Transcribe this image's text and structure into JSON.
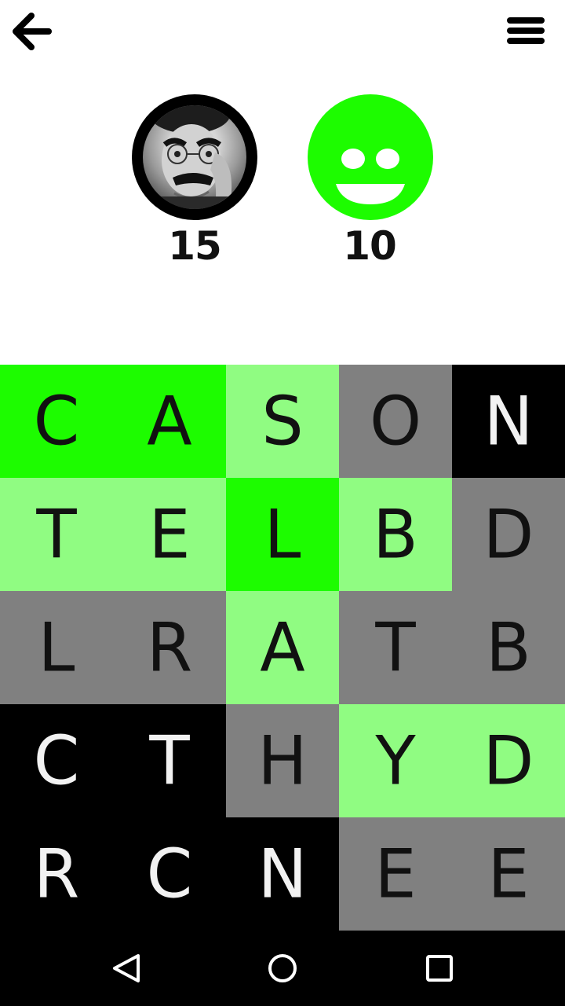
{
  "toolbar": {
    "back_icon": "arrow-left-icon",
    "menu_icon": "hamburger-menu-icon"
  },
  "players": [
    {
      "avatar": "player-photo",
      "score": "15"
    },
    {
      "avatar": "green-smiley",
      "score": "10"
    }
  ],
  "colors": {
    "bright_green": "#1dfc00",
    "light_green": "#90fc82",
    "gray": "#808080",
    "black": "#000000",
    "dark_letter": "#111111",
    "light_letter": "#f2f2f2"
  },
  "board": {
    "rows": [
      [
        {
          "letter": "C",
          "state": "bright_green"
        },
        {
          "letter": "A",
          "state": "bright_green"
        },
        {
          "letter": "S",
          "state": "light_green"
        },
        {
          "letter": "O",
          "state": "gray"
        },
        {
          "letter": "N",
          "state": "black"
        }
      ],
      [
        {
          "letter": "T",
          "state": "light_green"
        },
        {
          "letter": "E",
          "state": "light_green"
        },
        {
          "letter": "L",
          "state": "bright_green"
        },
        {
          "letter": "B",
          "state": "light_green"
        },
        {
          "letter": "D",
          "state": "gray"
        }
      ],
      [
        {
          "letter": "L",
          "state": "gray"
        },
        {
          "letter": "R",
          "state": "gray"
        },
        {
          "letter": "A",
          "state": "light_green"
        },
        {
          "letter": "T",
          "state": "gray"
        },
        {
          "letter": "B",
          "state": "gray"
        }
      ],
      [
        {
          "letter": "C",
          "state": "black"
        },
        {
          "letter": "T",
          "state": "black"
        },
        {
          "letter": "H",
          "state": "gray"
        },
        {
          "letter": "Y",
          "state": "light_green"
        },
        {
          "letter": "D",
          "state": "light_green"
        }
      ],
      [
        {
          "letter": "R",
          "state": "black"
        },
        {
          "letter": "C",
          "state": "black"
        },
        {
          "letter": "N",
          "state": "black"
        },
        {
          "letter": "E",
          "state": "gray"
        },
        {
          "letter": "E",
          "state": "gray"
        }
      ]
    ]
  },
  "navbar": {
    "back_icon": "triangle-back-icon",
    "home_icon": "circle-home-icon",
    "recent_icon": "square-recents-icon"
  }
}
